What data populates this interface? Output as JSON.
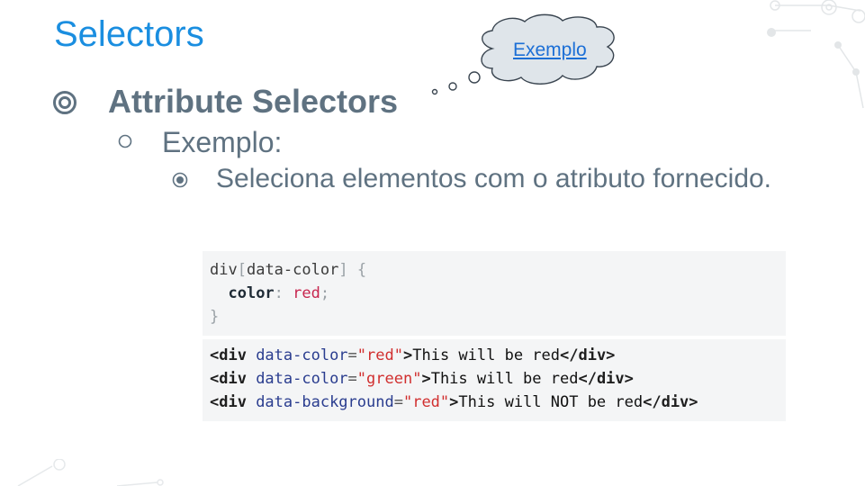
{
  "slide": {
    "title": "Selectors",
    "callout": {
      "link_text": "Exemplo"
    },
    "bullets": {
      "level1": "Attribute Selectors",
      "level2": "Exemplo:",
      "level3": "Seleciona elementos com o atributo fornecido."
    }
  },
  "code": {
    "css": {
      "line1": {
        "selector": "div",
        "open_bracket": "[",
        "attr": "data-color",
        "close_bracket": "]",
        "brace": " {"
      },
      "line2": {
        "indent": "  ",
        "property": "color",
        "colon": ": ",
        "value": "red",
        "semicolon": ";"
      },
      "line3": {
        "brace": "}"
      }
    },
    "html": [
      {
        "tag_open": "<div",
        "attr": " data-color",
        "eq": "=",
        "value": "\"red\"",
        "close": ">",
        "text": "This will be red",
        "tag_close": "</div>"
      },
      {
        "tag_open": "<div",
        "attr": " data-color",
        "eq": "=",
        "value": "\"green\"",
        "close": ">",
        "text": "This will be red",
        "tag_close": "</div>"
      },
      {
        "tag_open": "<div",
        "attr": " data-background",
        "eq": "=",
        "value": "\"red\"",
        "close": ">",
        "text": "This will NOT be red",
        "tag_close": "</div>"
      }
    ]
  },
  "colors": {
    "title": "#1a8ee0",
    "bullet_text": "#5f7281",
    "link": "#1c6fd6",
    "code_background": "#f4f5f6",
    "string_red": "#d12f2f",
    "attr_blue": "#2a3d8f"
  },
  "icons": {
    "level1_bullet": "double-circle-icon",
    "level2_bullet": "hollow-circle-icon",
    "level3_bullet": "dot-circle-icon",
    "callout": "thought-bubble-icon",
    "decoration": "network-nodes-icon"
  }
}
